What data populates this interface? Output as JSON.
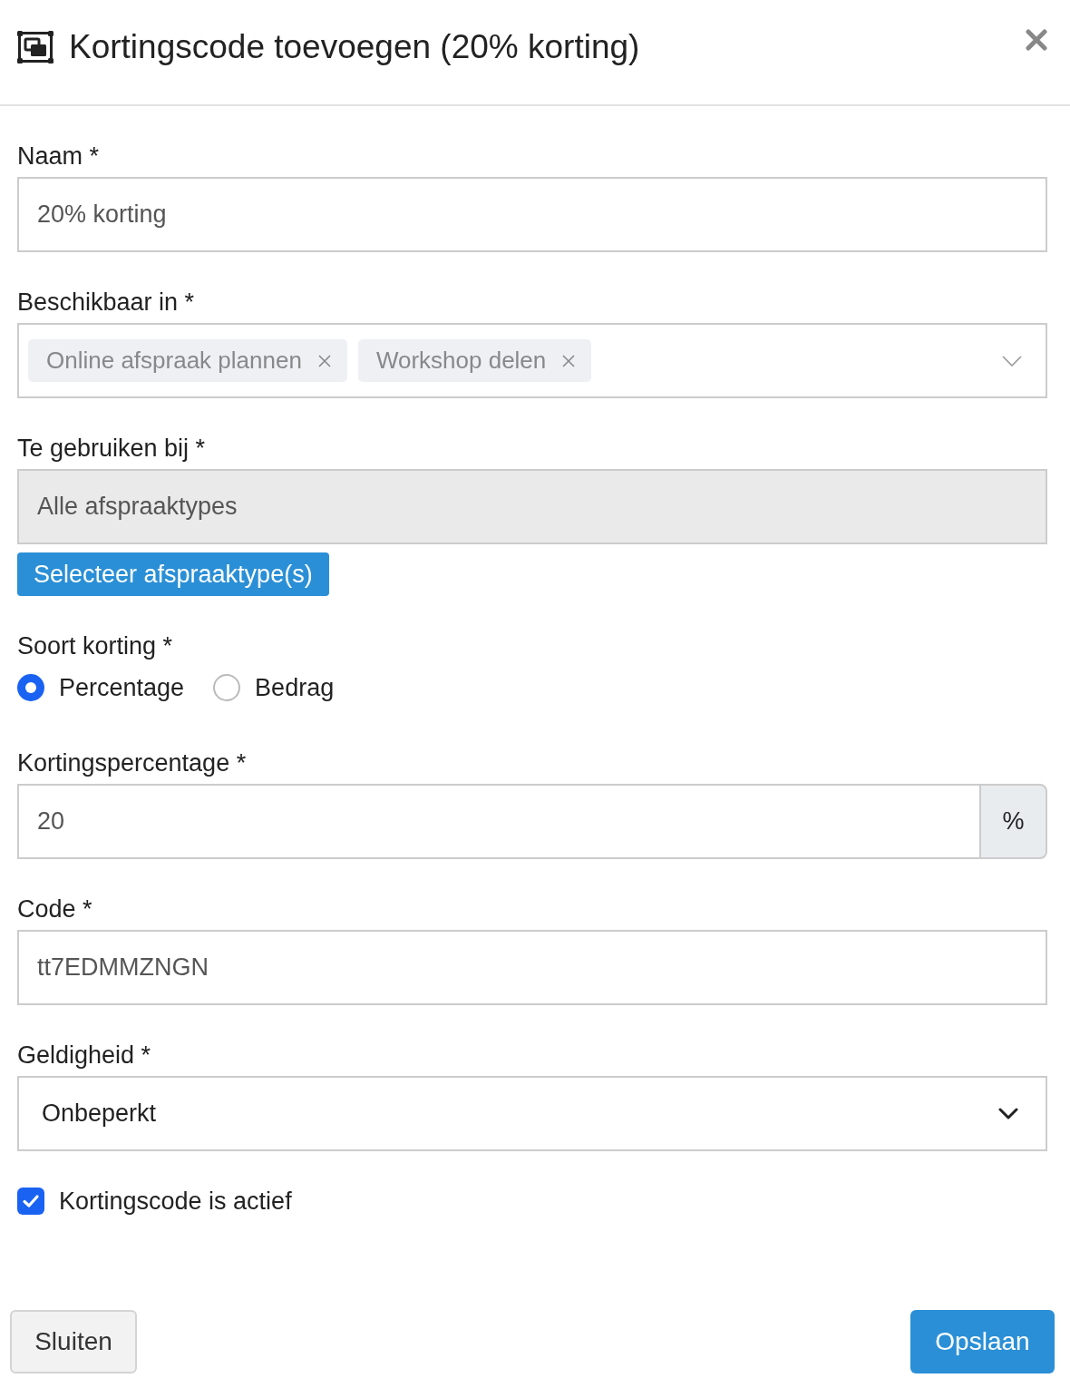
{
  "dialog": {
    "title": "Kortingscode toevoegen (20% korting)"
  },
  "fields": [
    {
      "kind": "text",
      "label": "Naam *",
      "value": "20% korting"
    },
    {
      "kind": "tags",
      "label": "Beschikbaar in *",
      "tags": [
        "Online afspraak plannen",
        "Workshop delen"
      ]
    },
    {
      "kind": "picker",
      "label": "Te gebruiken bij *",
      "value": "Alle afspraaktypes",
      "disabled": true,
      "button": "Selecteer afspraaktype(s)"
    },
    {
      "kind": "radio",
      "label": "Soort korting *",
      "options": [
        {
          "label": "Percentage",
          "selected": true
        },
        {
          "label": "Bedrag",
          "selected": false
        }
      ]
    },
    {
      "kind": "addon",
      "label": "Kortingspercentage *",
      "value": "20",
      "addon": "%"
    },
    {
      "kind": "text",
      "label": "Code *",
      "value": "tt7EDMMZNGN"
    },
    {
      "kind": "select",
      "label": "Geldigheid *",
      "value": "Onbeperkt"
    },
    {
      "kind": "checkbox",
      "label": "Kortingscode is actief",
      "checked": true
    }
  ],
  "footer": {
    "buttons": [
      {
        "kind": "secondary",
        "label": "Sluiten"
      },
      {
        "kind": "primary",
        "label": "Opslaan"
      }
    ]
  }
}
